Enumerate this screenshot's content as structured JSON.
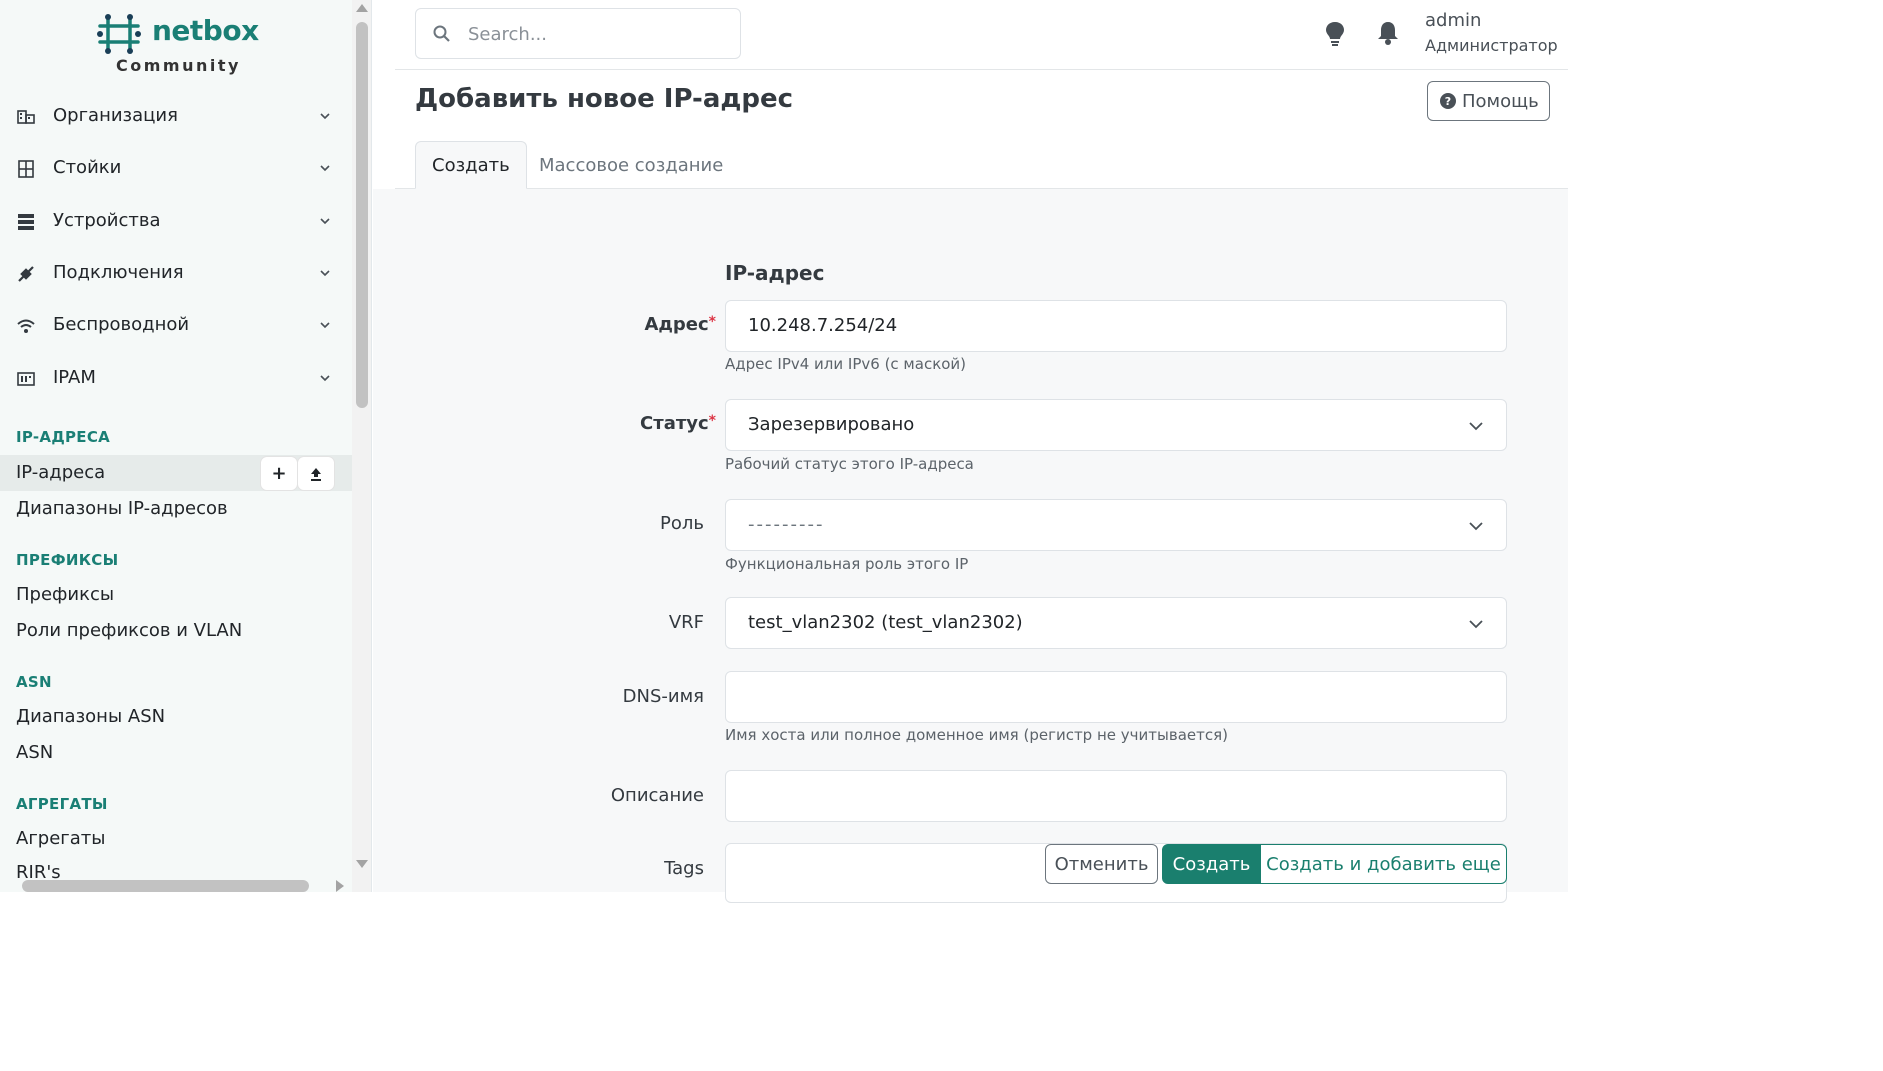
{
  "brand": {
    "name": "netbox",
    "edition": "Community",
    "accent": "#1a7f75"
  },
  "sidebar": {
    "groups": [
      {
        "label": "Организация",
        "icon": "domain-icon"
      },
      {
        "label": "Стойки",
        "icon": "rack-icon"
      },
      {
        "label": "Устройства",
        "icon": "server-icon"
      },
      {
        "label": "Подключения",
        "icon": "connection-icon"
      },
      {
        "label": "Беспроводной",
        "icon": "wifi-icon"
      },
      {
        "label": "IPAM",
        "icon": "ipam-icon"
      }
    ],
    "sections": [
      {
        "title": "IP-АДРЕСА",
        "items": [
          "IP-адреса",
          "Диапазоны IP-адресов"
        ]
      },
      {
        "title": "ПРЕФИКСЫ",
        "items": [
          "Префиксы",
          "Роли префиксов и VLAN"
        ]
      },
      {
        "title": "ASN",
        "items": [
          "Диапазоны ASN",
          "ASN"
        ]
      },
      {
        "title": "АГРЕГАТЫ",
        "items": [
          "Агрегаты",
          "RIR's"
        ]
      }
    ],
    "active_item": "IP-адреса",
    "active_actions": {
      "add": "+",
      "import": "⬆"
    }
  },
  "header": {
    "search_placeholder": "Search...",
    "user": {
      "name": "admin",
      "role": "Администратор"
    }
  },
  "page": {
    "title": "Добавить новое IP-адрес",
    "help_label": "Помощь",
    "tabs": [
      {
        "label": "Создать",
        "active": true
      },
      {
        "label": "Массовое создание",
        "active": false
      }
    ]
  },
  "form": {
    "section_title": "IP-адрес",
    "fields": [
      {
        "label": "Адрес",
        "required": true,
        "value": "10.248.7.254/24",
        "help": "Адрес IPv4 или IPv6 (с маской)"
      },
      {
        "label": "Статус",
        "required": true,
        "value": "Зарезервировано",
        "help": "Рабочий статус этого IP-адреса"
      },
      {
        "label": "Роль",
        "required": false,
        "value": "---------",
        "help": "Функциональная роль этого IP"
      },
      {
        "label": "VRF",
        "required": false,
        "value": "test_vlan2302 (test_vlan2302)",
        "help": ""
      },
      {
        "label": "DNS-имя",
        "required": false,
        "value": "",
        "help": "Имя хоста или полное доменное имя (регистр не учитывается)"
      },
      {
        "label": "Описание",
        "required": false,
        "value": "",
        "help": ""
      },
      {
        "label": "Tags",
        "required": false,
        "value": "",
        "help": ""
      }
    ],
    "required_mark": "*",
    "buttons": {
      "cancel": "Отменить",
      "create": "Создать",
      "create_more": "Создать и добавить еще"
    }
  }
}
